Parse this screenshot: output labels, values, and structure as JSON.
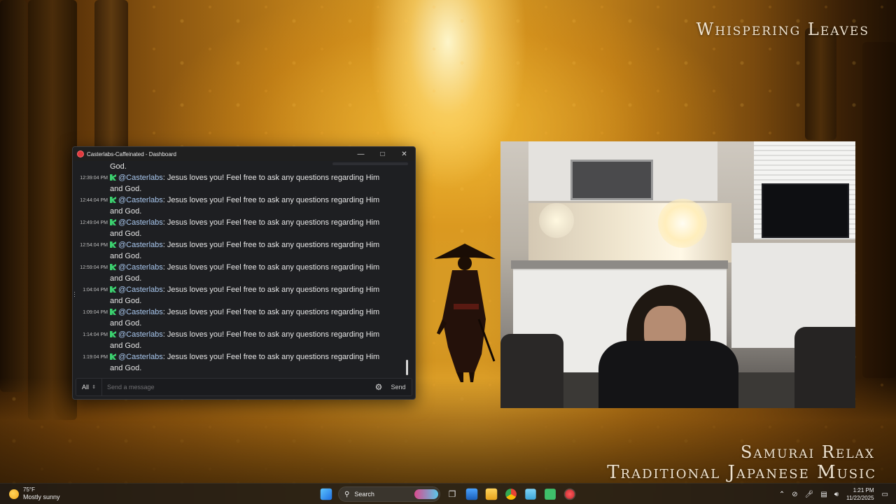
{
  "overlay": {
    "top_title": "Whispering Leaves",
    "bottom_line1": "Samurai Relax",
    "bottom_line2": "Traditional Japanese Music"
  },
  "window": {
    "title": "Casterlabs-Caffeinated - Dashboard",
    "minimize_icon": "minimize-icon",
    "maximize_icon": "maximize-icon",
    "close_icon": "close-icon"
  },
  "chat": {
    "first_line": "God.",
    "messages": [
      {
        "time": "12:39:04 PM",
        "user": "@Casterlabs",
        "text": ": Jesus loves you! Feel free to ask any questions regarding Him and God."
      },
      {
        "time": "12:44:04 PM",
        "user": "@Casterlabs",
        "text": ": Jesus loves you! Feel free to ask any questions regarding Him and God."
      },
      {
        "time": "12:49:04 PM",
        "user": "@Casterlabs",
        "text": ": Jesus loves you! Feel free to ask any questions regarding Him and God."
      },
      {
        "time": "12:54:04 PM",
        "user": "@Casterlabs",
        "text": ": Jesus loves you! Feel free to ask any questions regarding Him and God."
      },
      {
        "time": "12:59:04 PM",
        "user": "@Casterlabs",
        "text": ": Jesus loves you! Feel free to ask any questions regarding Him and God."
      },
      {
        "time": "1:04:04 PM",
        "user": "@Casterlabs",
        "text": ": Jesus loves you! Feel free to ask any questions regarding Him and God."
      },
      {
        "time": "1:09:04 PM",
        "user": "@Casterlabs",
        "text": ": Jesus loves you! Feel free to ask any questions regarding Him and God."
      },
      {
        "time": "1:14:04 PM",
        "user": "@Casterlabs",
        "text": ": Jesus loves you! Feel free to ask any questions regarding Him and God."
      },
      {
        "time": "1:19:04 PM",
        "user": "@Casterlabs",
        "text": ": Jesus loves you! Feel free to ask any questions regarding Him and God."
      }
    ],
    "badge_icon": "kick-badge-icon",
    "badge_color": "#3bd16f",
    "username_color": "#a9c8ef"
  },
  "composer": {
    "filter_value": "All",
    "placeholder": "Send a message",
    "settings_icon": "gear-icon",
    "send_label": "Send"
  },
  "taskbar": {
    "weather_temp": "75°F",
    "weather_desc": "Mostly sunny",
    "search_label": "Search",
    "apps": [
      "start-icon",
      "task-view-icon",
      "photos-icon",
      "file-explorer-icon",
      "chrome-icon",
      "notepad-icon",
      "app-icon",
      "casterlabs-icon"
    ],
    "time": "1:21 PM",
    "date": "11/22/2025"
  }
}
